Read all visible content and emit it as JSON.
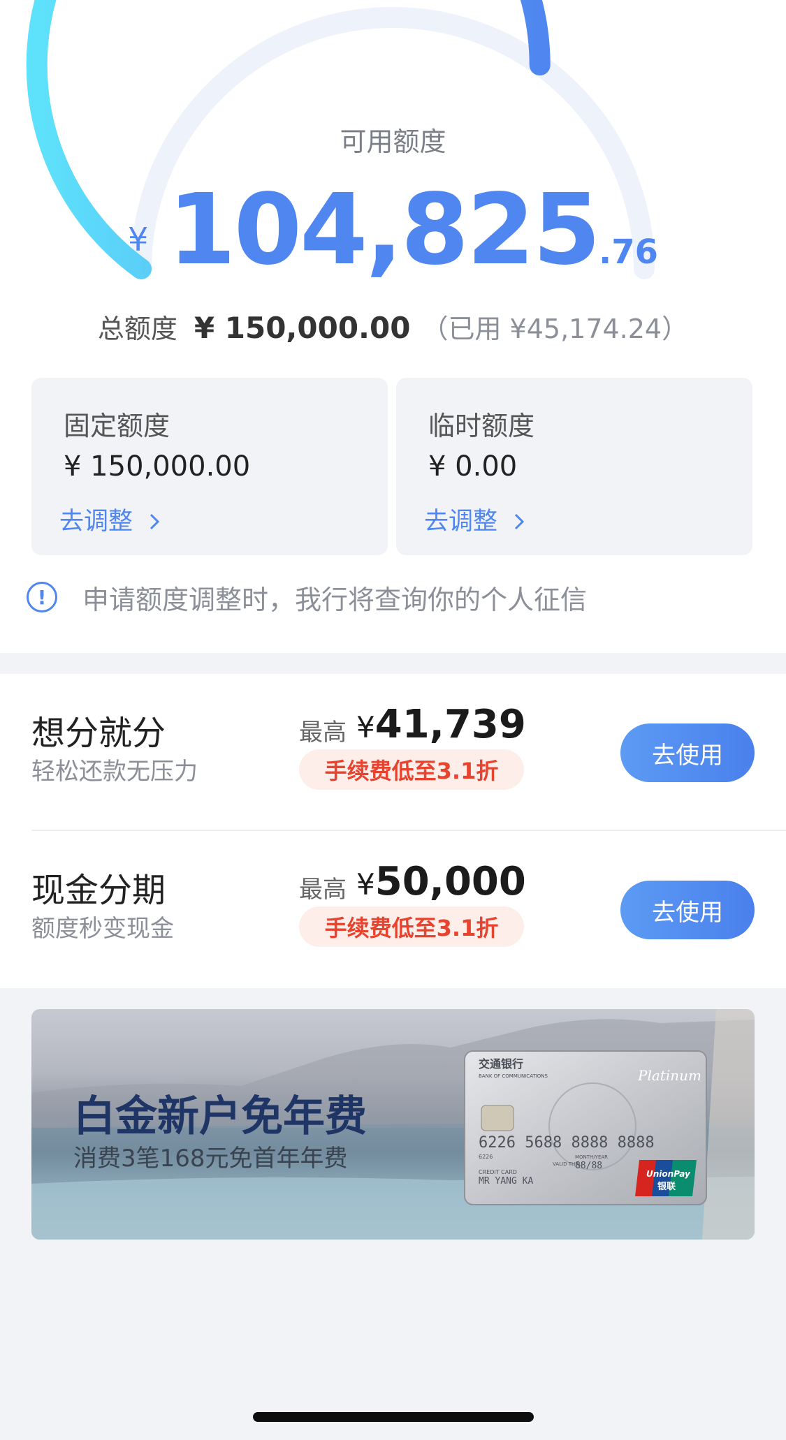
{
  "credit": {
    "available_label": "可用额度",
    "currency": "¥",
    "available_int": "104,825",
    "available_dec": ".76",
    "available_fraction": 0.699,
    "total_label": "总额度",
    "total_value": "¥ 150,000.00",
    "used_text": "（已用 ¥45,174.24）"
  },
  "limits": [
    {
      "title": "固定额度",
      "value": "¥ 150,000.00",
      "action": "去调整"
    },
    {
      "title": "临时额度",
      "value": "¥ 0.00",
      "action": "去调整"
    }
  ],
  "notice": {
    "text": "申请额度调整时，我行将查询你的个人征信"
  },
  "offers": [
    {
      "name": "想分就分",
      "desc": "轻松还款无压力",
      "max_label": "最高",
      "max_currency": "¥",
      "max_value": "41,739",
      "fee": "手续费低至3.1折",
      "button": "去使用"
    },
    {
      "name": "现金分期",
      "desc": "额度秒变现金",
      "max_label": "最高",
      "max_currency": "¥",
      "max_value": "50,000",
      "fee": "手续费低至3.1折",
      "button": "去使用"
    }
  ],
  "banner": {
    "title": "白金新户免年费",
    "subtitle": "消费3笔168元免首年年费",
    "card": {
      "bank_name": "交通银行",
      "bank_en": "BANK OF COMMUNICATIONS",
      "tier": "Platinum",
      "number": "6226 5688 8888 8888",
      "number_small": "6226",
      "valid_label_1": "MONTH/YEAR",
      "valid_label_2": "VALID THRU",
      "valid": "88/88",
      "card_type": "CREDIT CARD",
      "holder": "MR YANG KA",
      "network": "UnionPay",
      "network_cn": "银联"
    }
  },
  "colors": {
    "accent": "#4f86ef",
    "fee_red": "#e8432f"
  }
}
